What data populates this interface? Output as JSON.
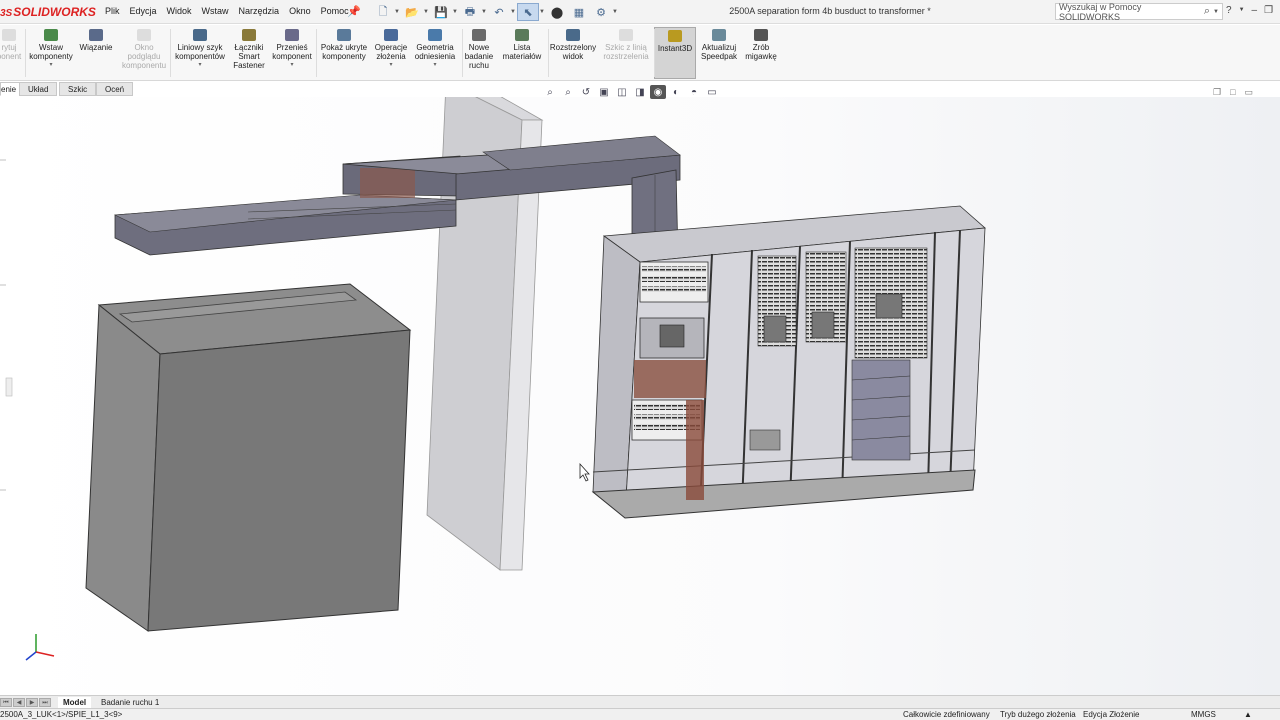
{
  "app": {
    "logo": "SOLIDWORKS",
    "logo_prefix": "3S"
  },
  "menu": [
    "Plik",
    "Edycja",
    "Widok",
    "Wstaw",
    "Narzędzia",
    "Okno",
    "Pomoc"
  ],
  "document_title": "2500A separation form 4b busduct to transformer *",
  "search": {
    "placeholder": "Wyszukaj w Pomocy SOLIDWORKS"
  },
  "ribbon": {
    "items": [
      {
        "label": "rytuj\nponent",
        "icon": "edit-component-icon",
        "disabled": true
      },
      {
        "label": "Wstaw\nkomponenty",
        "icon": "insert-components-icon"
      },
      {
        "label": "Wiązanie",
        "icon": "mate-icon"
      },
      {
        "label": "Okno\npodglądu\nkomponentu",
        "icon": "component-preview-icon",
        "disabled": true
      },
      {
        "label": "Liniowy szyk\nkomponentów",
        "icon": "linear-pattern-icon"
      },
      {
        "label": "Łączniki\nSmart\nFastener",
        "icon": "smart-fastener-icon"
      },
      {
        "label": "Przenieś\nkomponent",
        "icon": "move-component-icon"
      },
      {
        "label": "Pokaż ukryte\nkomponenty",
        "icon": "show-hidden-icon"
      },
      {
        "label": "Operacje\nzłożenia",
        "icon": "assembly-features-icon"
      },
      {
        "label": "Geometria\nodniesienia",
        "icon": "reference-geometry-icon"
      },
      {
        "label": "Nowe\nbadanie\nruchu",
        "icon": "motion-study-icon"
      },
      {
        "label": "Lista\nmateriałów",
        "icon": "bom-icon"
      },
      {
        "label": "Rozstrzelony\nwidok",
        "icon": "exploded-view-icon"
      },
      {
        "label": "Szkic z linią\nrozstrzelenia",
        "icon": "explode-line-sketch-icon",
        "disabled": true
      },
      {
        "label": "Instant3D",
        "icon": "instant3d-icon",
        "active": true
      },
      {
        "label": "Aktualizuj\nSpeedpak",
        "icon": "speedpak-icon"
      },
      {
        "label": "Zrób\nmigawkę",
        "icon": "snapshot-icon"
      }
    ]
  },
  "tabs": [
    "enie",
    "Układ",
    "Szkic",
    "Oceń"
  ],
  "bottom_tabs": [
    "Model",
    "Badanie ruchu 1"
  ],
  "status": {
    "path": "2500A_3_LUK<1>/SPIE_L1_3<9>",
    "defined": "Całkowicie zdefiniowany",
    "mode": "Tryb dużego złożenia",
    "editing": "Edycja Złożenie",
    "units": "MMGS"
  },
  "colors": {
    "accent": "#d22222",
    "selected": "#c7d9ef",
    "box_front": "#7a7a7a",
    "busduct": "#6b6b7a"
  }
}
